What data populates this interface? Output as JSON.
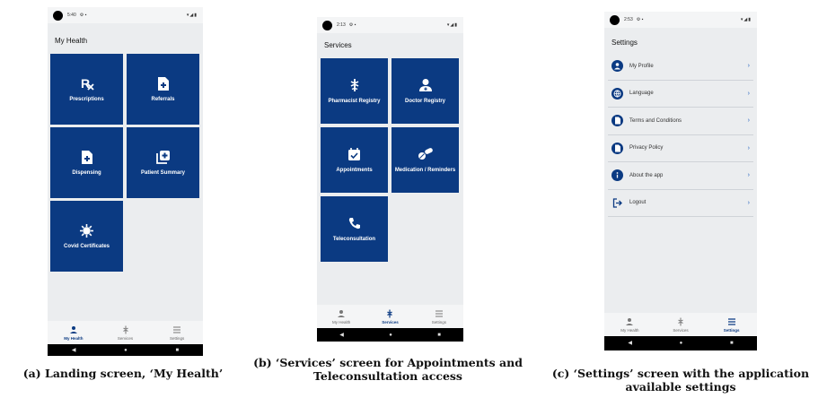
{
  "screen_a": {
    "status_time": "5:40",
    "title": "My Health",
    "tiles": [
      {
        "label": "Prescriptions",
        "icon": "rx-icon"
      },
      {
        "label": "Referrals",
        "icon": "document-plus-icon"
      },
      {
        "label": "Dispensing",
        "icon": "document-plus-icon"
      },
      {
        "label": "Patient Summary",
        "icon": "medical-folder-icon"
      },
      {
        "label": "Covid Certificates",
        "icon": "virus-icon"
      }
    ],
    "nav": [
      {
        "label": "My Health",
        "active": true
      },
      {
        "label": "Services",
        "active": false
      },
      {
        "label": "Settings",
        "active": false
      }
    ]
  },
  "screen_b": {
    "status_time": "2:13",
    "title": "Services",
    "tiles": [
      {
        "label": "Pharmacist Registry",
        "icon": "pharmacy-icon"
      },
      {
        "label": "Doctor Registry",
        "icon": "doctor-icon"
      },
      {
        "label": "Appointments",
        "icon": "calendar-check-icon"
      },
      {
        "label": "Medication / Reminders",
        "icon": "pills-icon"
      },
      {
        "label": "Teleconsultation",
        "icon": "phone-icon"
      }
    ],
    "nav": [
      {
        "label": "My Health",
        "active": false
      },
      {
        "label": "Services",
        "active": true
      },
      {
        "label": "Settings",
        "active": false
      }
    ]
  },
  "screen_c": {
    "status_time": "2:53",
    "title": "Settings",
    "items": [
      {
        "label": "My Profile",
        "icon": "profile-icon"
      },
      {
        "label": "Language",
        "icon": "globe-icon"
      },
      {
        "label": "Terms and Conditions",
        "icon": "document-icon"
      },
      {
        "label": "Privacy Policy",
        "icon": "document-icon"
      },
      {
        "label": "About the app",
        "icon": "info-icon"
      },
      {
        "label": "Logout",
        "icon": "logout-icon"
      }
    ],
    "nav": [
      {
        "label": "My Health",
        "active": false
      },
      {
        "label": "Services",
        "active": false
      },
      {
        "label": "Settings",
        "active": true
      }
    ]
  },
  "captions": {
    "a": "(a) Landing screen, ‘My Health’",
    "b_line1": "(b) ‘Services’ screen for Appointments and",
    "b_line2": "Teleconsultation access",
    "c_line1": "(c) ‘Settings’ screen with the application",
    "c_line2": "available settings"
  },
  "colors": {
    "accent": "#0b3a82",
    "screen_bg": "#ebedef"
  }
}
